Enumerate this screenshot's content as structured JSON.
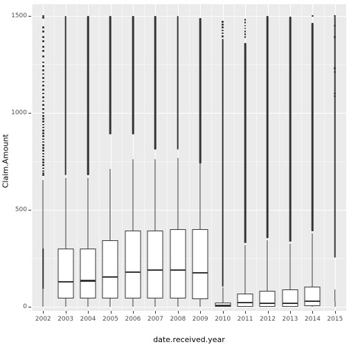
{
  "chart_data": {
    "type": "boxplot",
    "title": "",
    "xlabel": "date.received.year",
    "ylabel": "Claim.Amount",
    "categories": [
      "2002",
      "2003",
      "2004",
      "2005",
      "2006",
      "2007",
      "2008",
      "2009",
      "2010",
      "2011",
      "2012",
      "2013",
      "2014",
      "2015"
    ],
    "ylim": [
      -20,
      1560
    ],
    "y_ticks": [
      0,
      500,
      1000,
      1500
    ],
    "y_tick_labels": [
      "0",
      "500",
      "1000",
      "1500"
    ],
    "y_minor_ticks": [
      250,
      750,
      1250
    ],
    "grid": true,
    "legend": "none",
    "panel_background": "#ebebeb",
    "grid_color": "#ffffff",
    "series": [
      {
        "name": "Claim.Amount",
        "boxes": [
          {
            "category": "2002",
            "lower_whisker": 0,
            "q1": 95,
            "median": 95,
            "q3": 300,
            "upper_whisker": 655,
            "box_collapsed": true,
            "outlier_dense_top": 1500,
            "outlier_dense_bottom": 1500,
            "outliers": [
              1500,
              1490,
              1440,
              1420,
              1390,
              1370,
              1340,
              1320,
              1290,
              1260,
              1240,
              1220,
              1200,
              1180,
              1160,
              1140,
              1120,
              1100,
              1080,
              1060,
              1040,
              1020,
              1000,
              985,
              970,
              955,
              940,
              925,
              910,
              895,
              880,
              865,
              850,
              835,
              820,
              805,
              790,
              775,
              760,
              745,
              730,
              715,
              700,
              690,
              680
            ]
          },
          {
            "category": "2003",
            "lower_whisker": 0,
            "q1": 45,
            "median": 130,
            "q3": 300,
            "upper_whisker": 665,
            "box_collapsed": false,
            "outlier_dense_top": 1500,
            "outlier_dense_bottom": 680,
            "outliers": []
          },
          {
            "category": "2004",
            "lower_whisker": 0,
            "q1": 45,
            "median": 135,
            "q3": 300,
            "upper_whisker": 665,
            "box_collapsed": false,
            "outlier_dense_top": 1500,
            "outlier_dense_bottom": 680,
            "outliers": []
          },
          {
            "category": "2005",
            "lower_whisker": 0,
            "q1": 45,
            "median": 155,
            "q3": 345,
            "upper_whisker": 710,
            "box_collapsed": false,
            "outlier_dense_top": 1500,
            "outlier_dense_bottom": 890,
            "outliers": []
          },
          {
            "category": "2006",
            "lower_whisker": 0,
            "q1": 45,
            "median": 180,
            "q3": 395,
            "upper_whisker": 760,
            "box_collapsed": false,
            "outlier_dense_top": 1500,
            "outlier_dense_bottom": 890,
            "outliers": []
          },
          {
            "category": "2007",
            "lower_whisker": 0,
            "q1": 45,
            "median": 190,
            "q3": 395,
            "upper_whisker": 760,
            "box_collapsed": false,
            "outlier_dense_top": 1500,
            "outlier_dense_bottom": 810,
            "outliers": []
          },
          {
            "category": "2008",
            "lower_whisker": 0,
            "q1": 45,
            "median": 190,
            "q3": 400,
            "upper_whisker": 770,
            "box_collapsed": false,
            "outlier_dense_top": 1500,
            "outlier_dense_bottom": 810,
            "outliers": []
          },
          {
            "category": "2009",
            "lower_whisker": 0,
            "q1": 40,
            "median": 175,
            "q3": 400,
            "upper_whisker": 780,
            "box_collapsed": false,
            "outlier_dense_top": 1490,
            "outlier_dense_bottom": 740,
            "outliers": []
          },
          {
            "category": "2010",
            "lower_whisker": 0,
            "q1": 0,
            "median": 8,
            "q3": 22,
            "upper_whisker": 100,
            "box_collapsed": false,
            "outlier_dense_top": 1380,
            "outlier_dense_bottom": 105,
            "outliers": [
              1470,
              1455,
              1440,
              1425,
              1410,
              1395
            ]
          },
          {
            "category": "2011",
            "lower_whisker": 0,
            "q1": 0,
            "median": 22,
            "q3": 70,
            "upper_whisker": 320,
            "box_collapsed": false,
            "outlier_dense_top": 1360,
            "outlier_dense_bottom": 330,
            "outliers": [
              1480,
              1465,
              1450,
              1435,
              1420,
              1405,
              1390
            ]
          },
          {
            "category": "2012",
            "lower_whisker": 0,
            "q1": 0,
            "median": 20,
            "q3": 85,
            "upper_whisker": 345,
            "box_collapsed": false,
            "outlier_dense_top": 1500,
            "outlier_dense_bottom": 355,
            "outliers": []
          },
          {
            "category": "2013",
            "lower_whisker": 0,
            "q1": 0,
            "median": 20,
            "q3": 90,
            "upper_whisker": 325,
            "box_collapsed": false,
            "outlier_dense_top": 1495,
            "outlier_dense_bottom": 335,
            "outliers": [
              1430,
              1415,
              1400,
              1250,
              1235
            ]
          },
          {
            "category": "2014",
            "lower_whisker": 0,
            "q1": 5,
            "median": 30,
            "q3": 105,
            "upper_whisker": 380,
            "box_collapsed": false,
            "outlier_dense_top": 1465,
            "outlier_dense_bottom": 390,
            "outliers": [
              1500
            ]
          },
          {
            "category": "2015",
            "lower_whisker": 0,
            "q1": 30,
            "median": 30,
            "q3": 90,
            "upper_whisker": 90,
            "box_collapsed": true,
            "outlier_dense_top": 1495,
            "outlier_dense_bottom": 255,
            "outliers": [
              1500,
              1450,
              1390,
              1230,
              1210,
              1100,
              1085
            ]
          }
        ]
      }
    ]
  }
}
